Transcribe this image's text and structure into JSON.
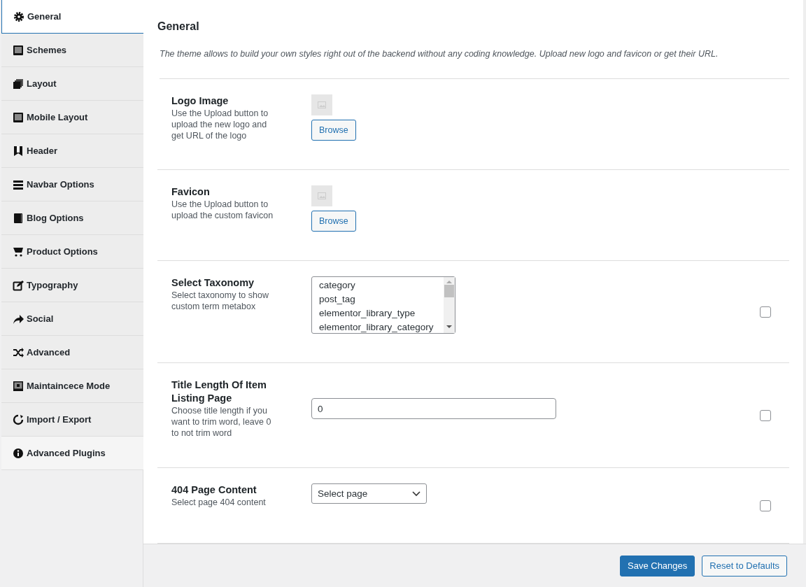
{
  "sidebar": {
    "items": [
      {
        "label": "General",
        "selected": true
      },
      {
        "label": "Schemes",
        "selected": false
      },
      {
        "label": "Layout",
        "selected": false
      },
      {
        "label": "Mobile Layout",
        "selected": false
      },
      {
        "label": "Header",
        "selected": false
      },
      {
        "label": "Navbar Options",
        "selected": false
      },
      {
        "label": "Blog Options",
        "selected": false
      },
      {
        "label": "Product Options",
        "selected": false
      },
      {
        "label": "Typography",
        "selected": false
      },
      {
        "label": "Social",
        "selected": false
      },
      {
        "label": "Advanced",
        "selected": false
      },
      {
        "label": "Maintaincece Mode",
        "selected": false
      },
      {
        "label": "Import / Export",
        "selected": false
      },
      {
        "label": "Advanced Plugins",
        "selected": false
      }
    ]
  },
  "section": {
    "title": "General",
    "description": "The theme allows to build your own styles right out of the backend without any coding knowledge. Upload new logo and favicon or get their URL."
  },
  "fields": [
    {
      "kind": "image",
      "title": "Logo Image",
      "description": "Use the Upload button to upload the new logo and get URL of the logo",
      "button": "Browse"
    },
    {
      "kind": "image",
      "title": "Favicon",
      "description": "Use the Upload button to upload the custom favicon",
      "button": "Browse"
    },
    {
      "kind": "listbox",
      "title": "Select Taxonomy",
      "description": "Select taxonomy to show custom term metabox",
      "options": [
        "category",
        "post_tag",
        "elementor_library_type",
        "elementor_library_category"
      ],
      "checkbox": {
        "checked": false
      }
    },
    {
      "kind": "text",
      "title": "Title Length Of Item Listing Page",
      "description": "Choose title length if you want to trim word, leave 0 to not trim word",
      "value": "0",
      "checkbox": {
        "checked": false
      }
    },
    {
      "kind": "select",
      "title": "404 Page Content",
      "description": "Select page 404 content",
      "value": "Select page",
      "checkbox": {
        "checked": false
      }
    }
  ],
  "footer": {
    "buttons": [
      {
        "label": "Save Changes",
        "kind": "primary"
      },
      {
        "label": "Reset to Defaults",
        "kind": "secondary"
      }
    ]
  }
}
